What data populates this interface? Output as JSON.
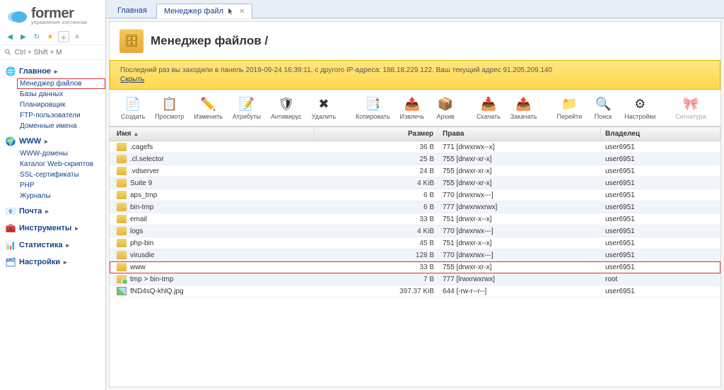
{
  "logo": {
    "text": "former",
    "sub": "управление хостингом"
  },
  "search": {
    "placeholder": "Ctrl + Shift + M"
  },
  "sidebar": [
    {
      "title": "Главное",
      "icon_color": "#4a4",
      "icon": "🌐",
      "items": [
        {
          "label": "Менеджер файлов",
          "highlight": true
        },
        {
          "label": "Базы данных"
        },
        {
          "label": "Планировщик"
        },
        {
          "label": "FTP-пользователи"
        },
        {
          "label": "Доменные имена"
        }
      ]
    },
    {
      "title": "WWW",
      "icon_color": "#4aa",
      "icon": "🌍",
      "items": [
        {
          "label": "WWW-домены"
        },
        {
          "label": "Каталог Web-скриптов"
        },
        {
          "label": "SSL-сертификаты"
        },
        {
          "label": "PHP"
        },
        {
          "label": "Журналы"
        }
      ]
    },
    {
      "title": "Почта",
      "icon_color": "#c66",
      "icon": "📧",
      "collapsed": true
    },
    {
      "title": "Инструменты",
      "icon_color": "#e84",
      "icon": "🧰",
      "collapsed": true
    },
    {
      "title": "Статистика",
      "icon_color": "#6a4",
      "icon": "📊",
      "collapsed": true
    },
    {
      "title": "Настройки",
      "icon_color": "#48c",
      "icon": "🗂",
      "collapsed": true
    }
  ],
  "tabs": [
    {
      "label": "Главная",
      "closable": false
    },
    {
      "label": "Менеджер файл",
      "closable": true,
      "active": true,
      "has_cursor": true
    }
  ],
  "page": {
    "title": "Менеджер файлов /"
  },
  "notice": {
    "text": "Последний раз вы заходили в панель 2019-09-24 16:39:11, с другого IP-адреса: 188.18.229.122. Ваш текущий адрес 91.205.209.140",
    "hide": "Скрыть"
  },
  "actions": [
    {
      "label": "Создать",
      "icon": "📄",
      "kind": "create"
    },
    {
      "label": "Просмотр",
      "icon": "📋",
      "kind": "view"
    },
    {
      "label": "Изменить",
      "icon": "✏️",
      "kind": "edit"
    },
    {
      "label": "Атрибуты",
      "icon": "📝",
      "kind": "attrs"
    },
    {
      "label": "Антивирус",
      "icon": "🛡",
      "kind": "av"
    },
    {
      "label": "Удалить",
      "icon": "✖",
      "kind": "delete"
    },
    {
      "sep": true
    },
    {
      "label": "Копировать",
      "icon": "📑",
      "kind": "copy"
    },
    {
      "label": "Извлечь",
      "icon": "📤",
      "kind": "extract"
    },
    {
      "label": "Архив",
      "icon": "📦",
      "kind": "archive"
    },
    {
      "sep": true
    },
    {
      "label": "Скачать",
      "icon": "📥",
      "kind": "download"
    },
    {
      "label": "Закачать",
      "icon": "📤",
      "kind": "upload"
    },
    {
      "sep": true
    },
    {
      "label": "Перейти",
      "icon": "📁",
      "kind": "goto"
    },
    {
      "label": "Поиск",
      "icon": "🔍",
      "kind": "search"
    },
    {
      "label": "Настройки",
      "icon": "⚙",
      "kind": "settings"
    },
    {
      "sep": true
    },
    {
      "label": "Сигнатура",
      "icon": "🎀",
      "kind": "sig",
      "disabled": true
    }
  ],
  "columns": {
    "name": "Имя",
    "size": "Размер",
    "perm": "Права",
    "owner": "Владелец"
  },
  "rows": [
    {
      "name": ".cagefs",
      "type": "folder",
      "size": "36 B",
      "perm": "771 [drwxrwx--x]",
      "owner": "user6951"
    },
    {
      "name": ".cl.selector",
      "type": "folder",
      "size": "25 B",
      "perm": "755 [drwxr-xr-x]",
      "owner": "user6951"
    },
    {
      "name": ".vdserver",
      "type": "folder",
      "size": "24 B",
      "perm": "755 [drwxr-xr-x]",
      "owner": "user6951"
    },
    {
      "name": "Suite 9",
      "type": "folder",
      "size": "4 KiB",
      "perm": "755 [drwxr-xr-x]",
      "owner": "user6951"
    },
    {
      "name": "aps_tmp",
      "type": "folder",
      "size": "6 B",
      "perm": "770 [drwxrwx---]",
      "owner": "user6951"
    },
    {
      "name": "bin-tmp",
      "type": "folder",
      "size": "6 B",
      "perm": "777 [drwxrwxrwx]",
      "owner": "user6951"
    },
    {
      "name": "email",
      "type": "folder",
      "size": "33 B",
      "perm": "751 [drwxr-x--x]",
      "owner": "user6951"
    },
    {
      "name": "logs",
      "type": "folder",
      "size": "4 KiB",
      "perm": "770 [drwxrwx---]",
      "owner": "user6951"
    },
    {
      "name": "php-bin",
      "type": "folder",
      "size": "45 B",
      "perm": "751 [drwxr-x--x]",
      "owner": "user6951"
    },
    {
      "name": "virusdie",
      "type": "folder",
      "size": "128 B",
      "perm": "770 [drwxrwx---]",
      "owner": "user6951"
    },
    {
      "name": "www",
      "type": "folder",
      "size": "33 B",
      "perm": "755 [drwxr-xr-x]",
      "owner": "user6951",
      "highlight": true
    },
    {
      "name": "tmp > bin-tmp",
      "type": "tmp",
      "size": "7 B",
      "perm": "777 [lrwxrwxrwx]",
      "owner": "root"
    },
    {
      "name": "fND4sQ-khlQ.jpg",
      "type": "image",
      "size": "397.37 KiB",
      "perm": "644 [-rw-r--r--]",
      "owner": "user6951"
    }
  ]
}
